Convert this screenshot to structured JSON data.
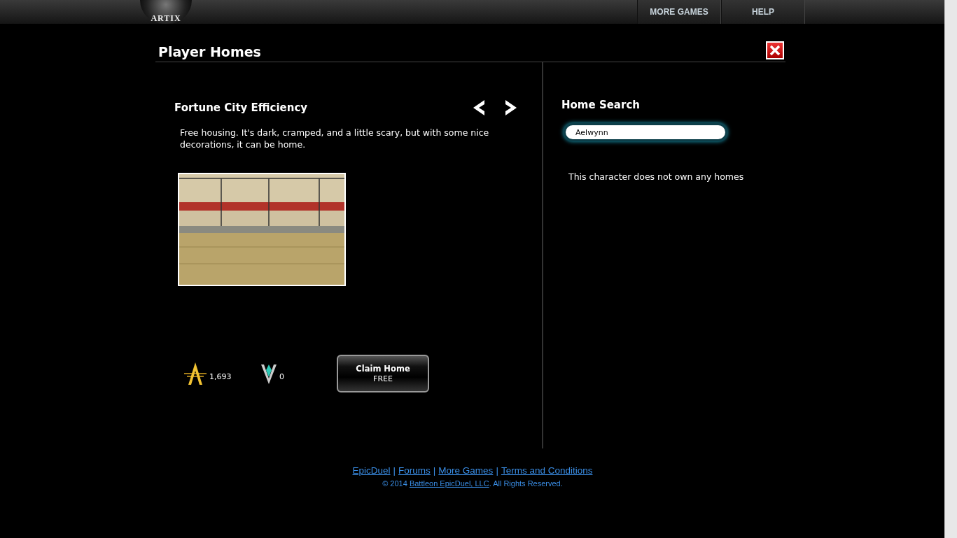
{
  "header": {
    "logo": "ARTIX",
    "nav": [
      {
        "label": "MORE GAMES"
      },
      {
        "label": "HELP"
      }
    ]
  },
  "title": "Player Homes",
  "home": {
    "name": "Fortune City Efficiency",
    "description": "Free housing. It's dark, cramped, and a little scary, but with some nice decorations, it can be home.",
    "currency": [
      {
        "kind": "credits",
        "amount": "1,693"
      },
      {
        "kind": "varium",
        "amount": "0"
      }
    ],
    "claim": {
      "label": "Claim Home",
      "price": "FREE"
    }
  },
  "search": {
    "title": "Home Search",
    "value": "Aelwynn",
    "message": "This character does not own any homes"
  },
  "footer": {
    "links": [
      "EpicDuel",
      "Forums",
      "More Games",
      "Terms and Conditions"
    ],
    "separator": "|",
    "copyright_prefix": "© 2014",
    "copyright_link": "Battleon EpicDuel, LLC",
    "copyright_suffix": ". All Rights Reserved."
  }
}
